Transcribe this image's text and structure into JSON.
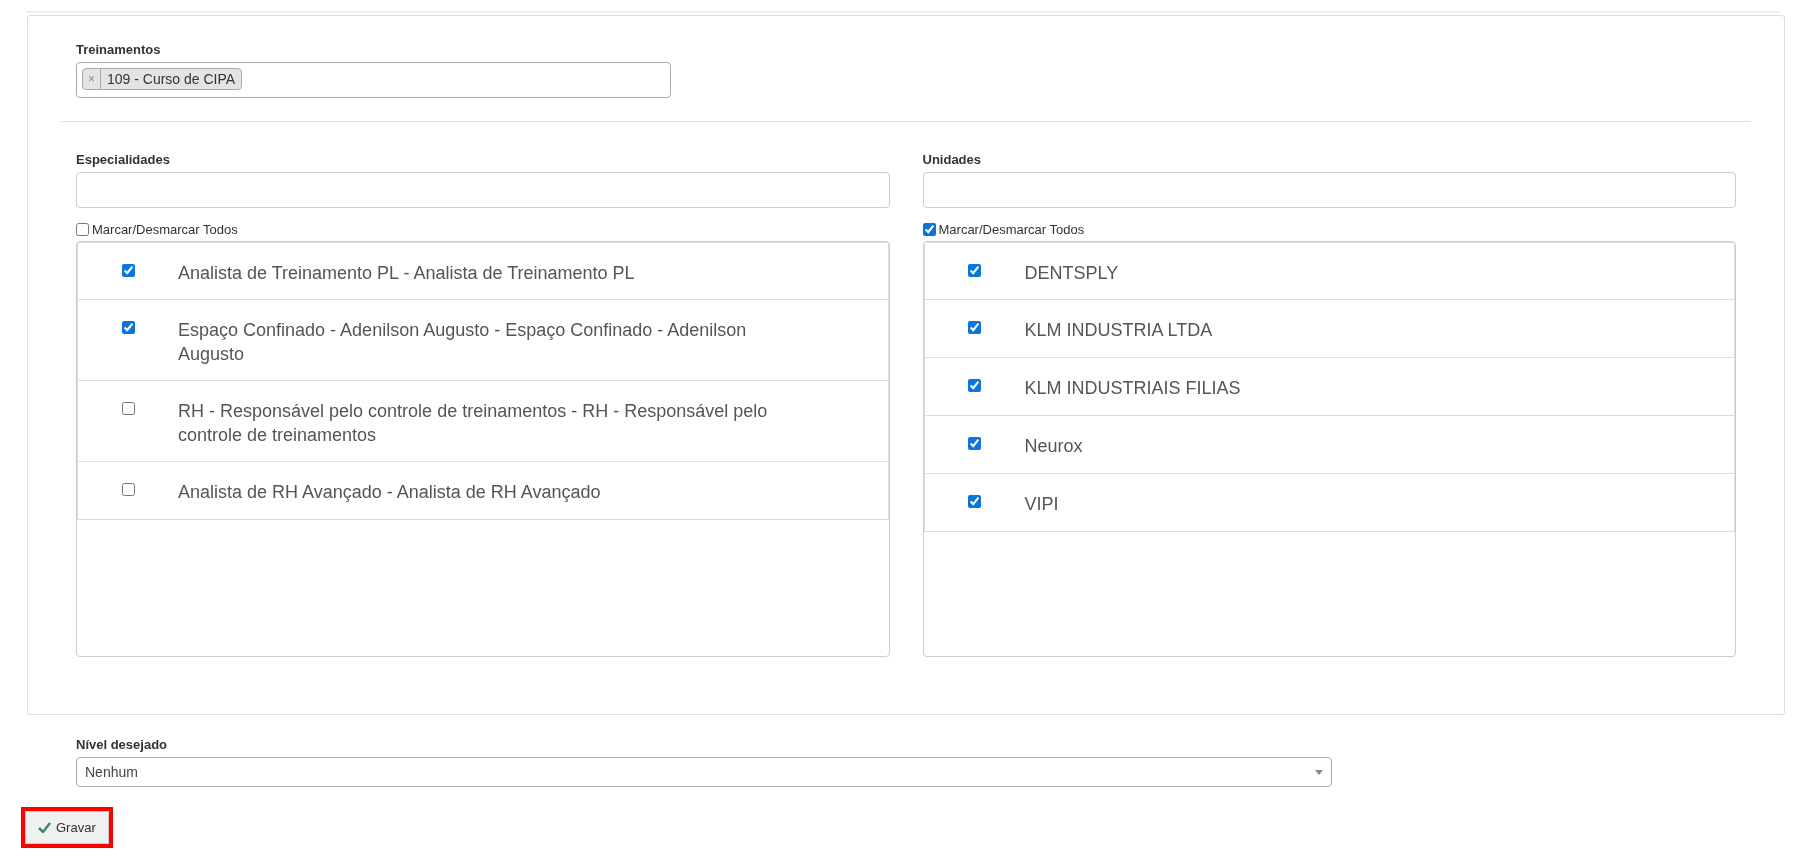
{
  "treinamentos": {
    "label": "Treinamentos",
    "tags": [
      {
        "remove": "×",
        "text": "109 - Curso de CIPA"
      }
    ]
  },
  "lists": [
    {
      "label": "Especialidades",
      "toggle_all": {
        "label": "Marcar/Desmarcar Todos",
        "checked": false
      },
      "items": [
        {
          "text": "Analista de Treinamento PL - Analista de Treinamento PL",
          "checked": true
        },
        {
          "text": "Espaço Confinado - Adenilson Augusto - Espaço Confinado - Adenilson Augusto",
          "checked": true
        },
        {
          "text": "RH - Responsável pelo controle de treinamentos - RH - Responsável pelo controle de treinamentos",
          "checked": false
        },
        {
          "text": "Analista de RH Avançado - Analista de RH Avançado",
          "checked": false
        }
      ]
    },
    {
      "label": "Unidades",
      "toggle_all": {
        "label": "Marcar/Desmarcar Todos",
        "checked": true
      },
      "items": [
        {
          "text": "DENTSPLY",
          "checked": true
        },
        {
          "text": "KLM INDUSTRIA LTDA",
          "checked": true
        },
        {
          "text": "KLM INDUSTRIAIS FILIAS",
          "checked": true
        },
        {
          "text": "Neurox",
          "checked": true
        },
        {
          "text": "VIPI",
          "checked": true
        }
      ]
    }
  ],
  "nivel": {
    "label": "Nível desejado",
    "value": "Nenhum"
  },
  "save_button": {
    "label": "Gravar"
  }
}
